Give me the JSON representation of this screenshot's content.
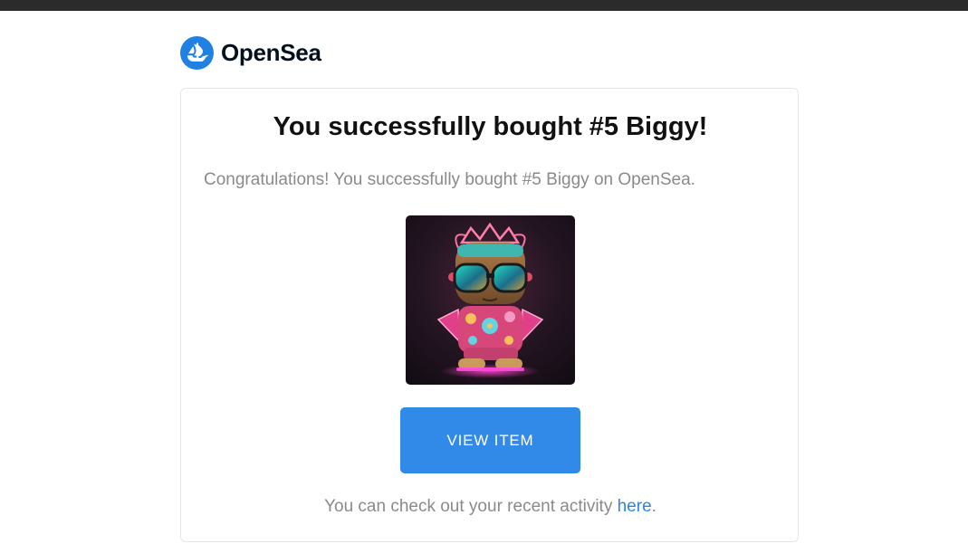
{
  "brand": {
    "name": "OpenSea",
    "color": "#2081E2",
    "logo_icon": "opensea-ship-icon"
  },
  "email": {
    "title": "You successfully bought #5 Biggy!",
    "message": "Congratulations! You successfully bought #5 Biggy on OpenSea.",
    "item_image": "nft-biggy-toy-image",
    "button_label": "VIEW ITEM",
    "button_color": "#318AE8",
    "footer_prefix": "You can check out your recent activity ",
    "footer_link": "here",
    "footer_suffix": "."
  }
}
